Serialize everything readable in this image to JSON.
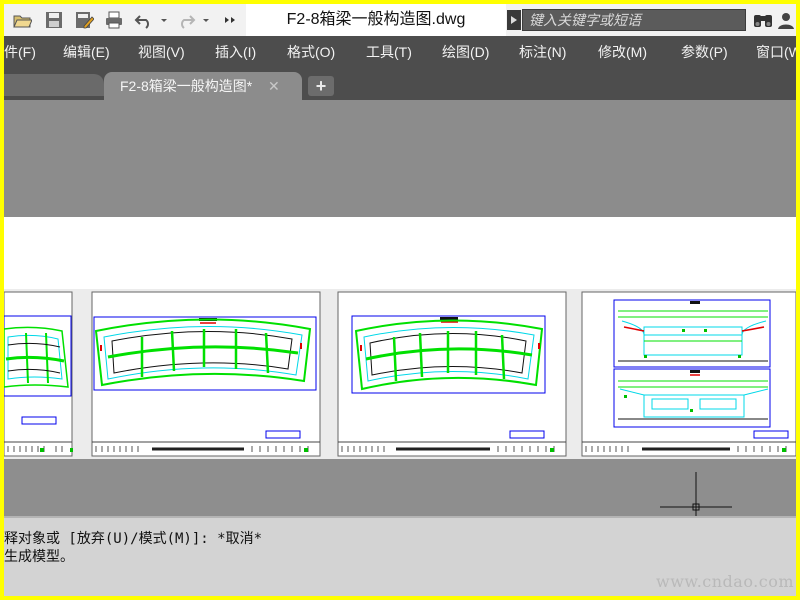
{
  "quick_access": {
    "icons": [
      "open-icon",
      "save-icon",
      "saveas-icon",
      "print-icon",
      "undo-icon",
      "undo-dropdown-icon",
      "redo-icon",
      "redo-dropdown-icon",
      "more-icon"
    ]
  },
  "title": {
    "document": "F2-8箱梁一般构造图.dwg"
  },
  "search": {
    "placeholder": "键入关键字或短语"
  },
  "menu": {
    "items": [
      "件(F)",
      "编辑(E)",
      "视图(V)",
      "插入(I)",
      "格式(O)",
      "工具(T)",
      "绘图(D)",
      "标注(N)",
      "修改(M)",
      "参数(P)",
      "窗口(W"
    ]
  },
  "tabs": {
    "active_label": "F2-8箱梁一般构造图*",
    "close_glyph": "✕",
    "add_glyph": "+"
  },
  "command": {
    "line1": "释对象或 [放弃(U)/模式(M)]: *取消*",
    "line2": "生成模型。"
  },
  "watermark": "www.cndao.com",
  "colors": {
    "drawing_green": "#00e000",
    "drawing_cyan": "#00d8e8",
    "drawing_blue": "#0000ee",
    "title_red": "#e00000",
    "viewport_gray": "#8c8c8c",
    "menubar": "#4d4d4d"
  }
}
